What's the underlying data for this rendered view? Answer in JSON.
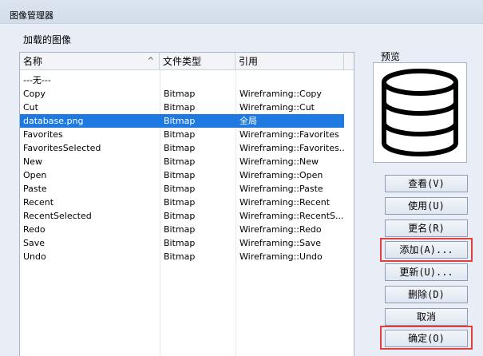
{
  "window": {
    "title": "图像管理器"
  },
  "group": {
    "label": "加载的图像"
  },
  "list": {
    "columns": [
      "名称",
      "文件类型",
      "引用"
    ],
    "sort_indicator": "^",
    "rows": [
      {
        "name": "---无---",
        "type": "",
        "ref": ""
      },
      {
        "name": "Copy",
        "type": "Bitmap",
        "ref": "Wireframing::Copy"
      },
      {
        "name": "Cut",
        "type": "Bitmap",
        "ref": "Wireframing::Cut"
      },
      {
        "name": "database.png",
        "type": "Bitmap",
        "ref": "全局"
      },
      {
        "name": "Favorites",
        "type": "Bitmap",
        "ref": "Wireframing::Favorites"
      },
      {
        "name": "FavoritesSelected",
        "type": "Bitmap",
        "ref": "Wireframing::Favorites..."
      },
      {
        "name": "New",
        "type": "Bitmap",
        "ref": "Wireframing::New"
      },
      {
        "name": "Open",
        "type": "Bitmap",
        "ref": "Wireframing::Open"
      },
      {
        "name": "Paste",
        "type": "Bitmap",
        "ref": "Wireframing::Paste"
      },
      {
        "name": "Recent",
        "type": "Bitmap",
        "ref": "Wireframing::Recent"
      },
      {
        "name": "RecentSelected",
        "type": "Bitmap",
        "ref": "Wireframing::RecentS..."
      },
      {
        "name": "Redo",
        "type": "Bitmap",
        "ref": "Wireframing::Redo"
      },
      {
        "name": "Save",
        "type": "Bitmap",
        "ref": "Wireframing::Save"
      },
      {
        "name": "Undo",
        "type": "Bitmap",
        "ref": "Wireframing::Undo"
      }
    ],
    "selected_index": 3
  },
  "preview": {
    "label": "预览",
    "icon": "database-icon"
  },
  "buttons": {
    "view": "查看(V)",
    "use": "使用(U)",
    "rename": "更名(R)",
    "add": "添加(A)...",
    "update": "更新(U)...",
    "delete": "删除(D)",
    "cancel": "取消",
    "ok": "确定(O)"
  },
  "highlight_color": "#e04040",
  "selection_color": "#1e7ae0"
}
